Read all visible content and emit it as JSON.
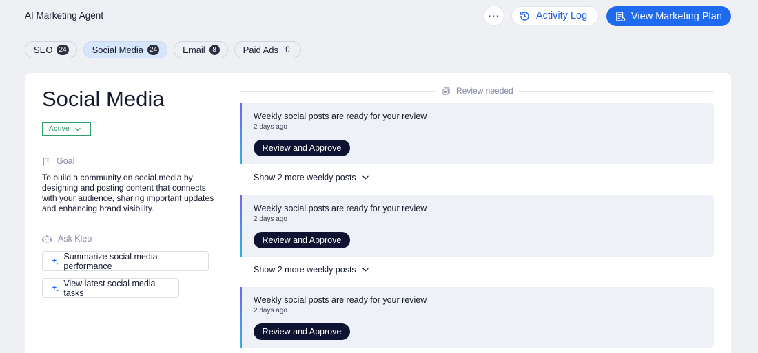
{
  "header": {
    "app_title": "AI Marketing Agent",
    "more_label": "···",
    "activity_log": "Activity Log",
    "view_plan": "View Marketing Plan"
  },
  "tabs": [
    {
      "label": "SEO",
      "count": "24"
    },
    {
      "label": "Social Media",
      "count": "24"
    },
    {
      "label": "Email",
      "count": "8"
    },
    {
      "label": "Paid Ads",
      "count": "0"
    }
  ],
  "sidebar": {
    "title": "Social Media",
    "status": "Active",
    "goal_heading": "Goal",
    "goal_text": "To build a community on social media by designing and posting content that connects with your audience, sharing important updates and enhancing brand visibility.",
    "ask_heading": "Ask Kleo",
    "ask_actions": [
      "Summarize social media performance",
      "View latest social media tasks"
    ]
  },
  "review": {
    "divider_label": "Review needed",
    "cards": [
      {
        "title": "Weekly social posts are ready for your review",
        "time": "2 days ago",
        "button": "Review and Approve"
      },
      {
        "title": "Weekly social posts are ready for your review",
        "time": "2 days ago",
        "button": "Review and Approve"
      },
      {
        "title": "Weekly social posts are ready for your review",
        "time": "2 days ago",
        "button": "Review and Approve"
      }
    ],
    "show_more": [
      "Show 2 more weekly posts",
      "Show 2 more weekly posts"
    ]
  },
  "colors": {
    "accent": "#1f6bf0",
    "tab_active_bg": "#d8e6fb",
    "status_green": "#2a8f5f",
    "button_dark": "#0d1330",
    "card_bg": "#eef1f8"
  }
}
